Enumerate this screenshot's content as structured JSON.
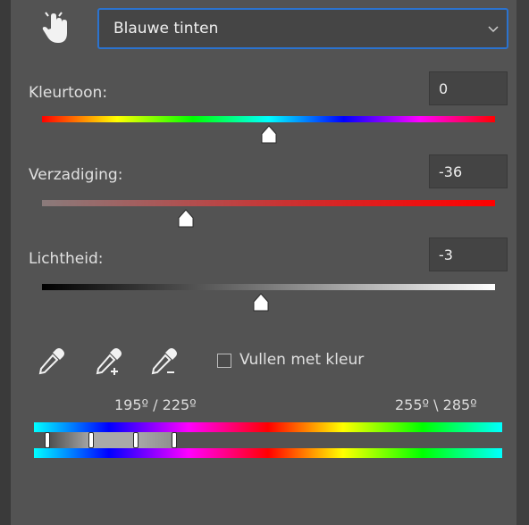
{
  "dropdown": {
    "selected": "Blauwe tinten"
  },
  "sliders": {
    "hue": {
      "label": "Kleurtoon:",
      "value": "0"
    },
    "saturation": {
      "label": "Verzadiging:",
      "value": "-36"
    },
    "lightness": {
      "label": "Lichtheid:",
      "value": "-3"
    }
  },
  "tools": {
    "fill_label": "Vullen met kleur",
    "fill_checked": false
  },
  "range": {
    "left": "195º / 225º",
    "right": "255º \\ 285º"
  },
  "icons": [
    "hand-target-icon",
    "chevron-down-icon",
    "eyedropper-icon",
    "eyedropper-plus-icon",
    "eyedropper-minus-icon"
  ],
  "colors": {
    "accent": "#2b73cf",
    "panel": "#535353"
  }
}
